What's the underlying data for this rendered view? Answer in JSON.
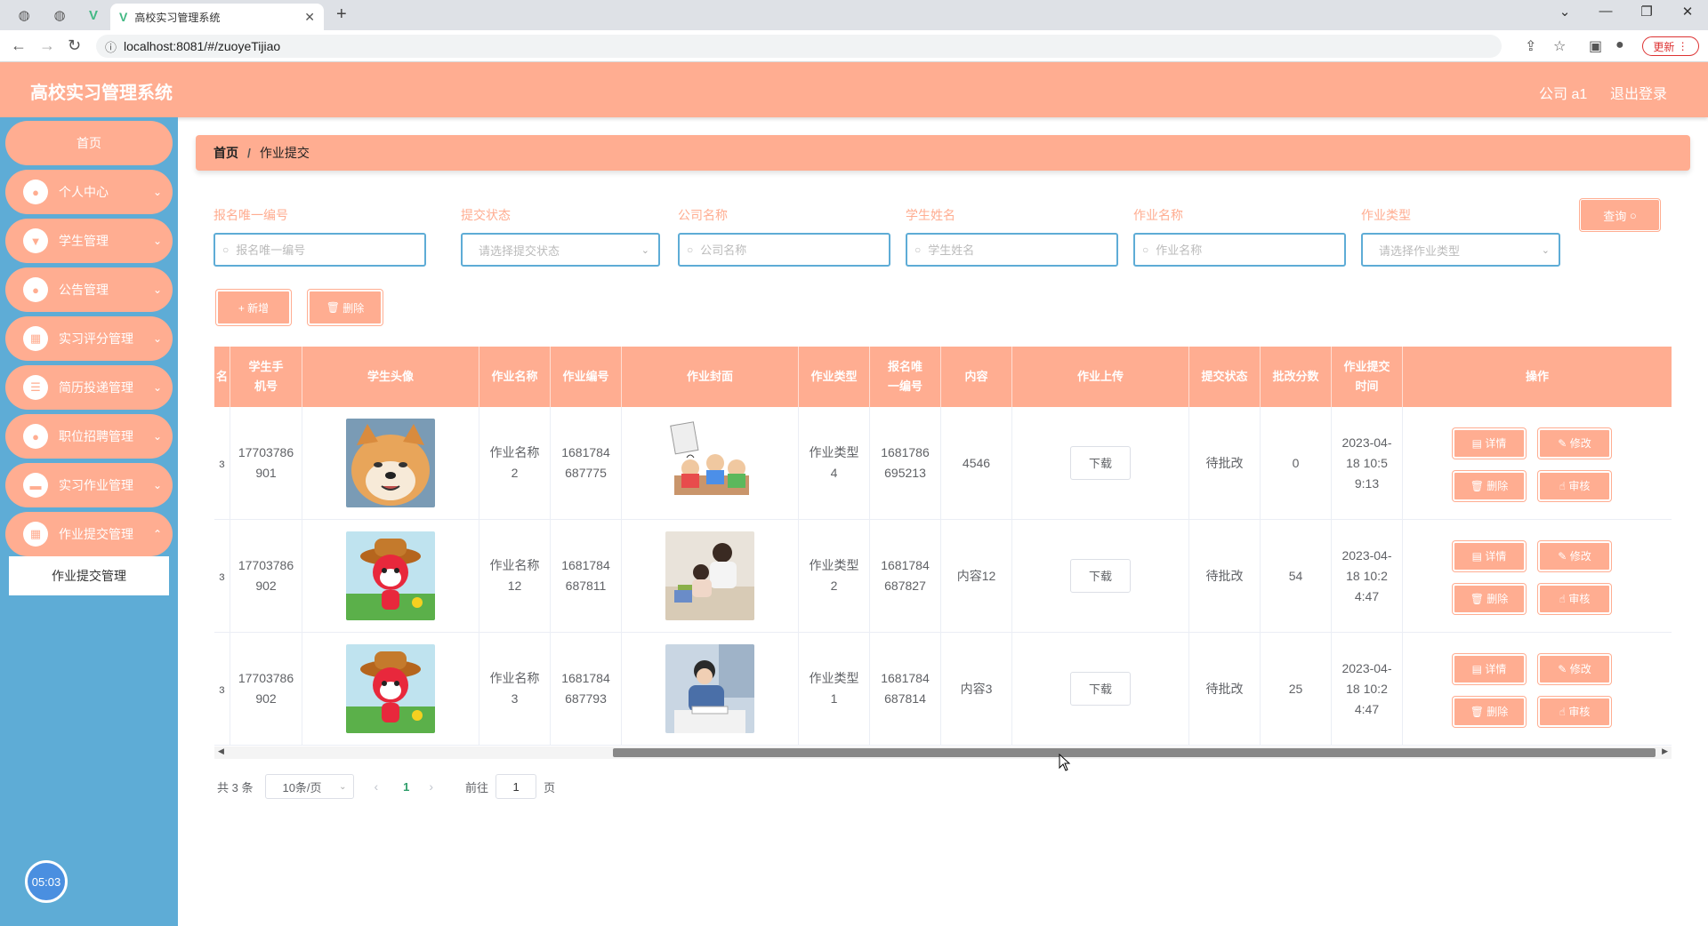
{
  "browser": {
    "tab_title": "高校实习管理系统",
    "url": "localhost:8081/#/zuoyeTijiao",
    "update_label": "更新"
  },
  "header": {
    "title": "高校实习管理系统",
    "user": "公司 a1",
    "logout": "退出登录"
  },
  "sidebar": {
    "items": [
      {
        "label": "首页",
        "icon": "home"
      },
      {
        "label": "个人中心",
        "icon": "user-icon"
      },
      {
        "label": "学生管理",
        "icon": "badge-icon"
      },
      {
        "label": "公告管理",
        "icon": "pin-icon"
      },
      {
        "label": "实习评分管理",
        "icon": "grid-icon"
      },
      {
        "label": "简历投递管理",
        "icon": "list-icon"
      },
      {
        "label": "职位招聘管理",
        "icon": "location-icon"
      },
      {
        "label": "实习作业管理",
        "icon": "monitor-icon"
      },
      {
        "label": "作业提交管理",
        "icon": "grid-icon"
      }
    ],
    "active_sub": "作业提交管理",
    "timer": "05:03"
  },
  "breadcrumb": {
    "home": "首页",
    "sep": "/",
    "current": "作业提交"
  },
  "search": {
    "fields": [
      {
        "label": "报名唯一编号",
        "placeholder": "报名唯一编号",
        "type": "input"
      },
      {
        "label": "提交状态",
        "placeholder": "请选择提交状态",
        "type": "select"
      },
      {
        "label": "公司名称",
        "placeholder": "公司名称",
        "type": "input"
      },
      {
        "label": "学生姓名",
        "placeholder": "学生姓名",
        "type": "input"
      },
      {
        "label": "作业名称",
        "placeholder": "作业名称",
        "type": "input"
      },
      {
        "label": "作业类型",
        "placeholder": "请选择作业类型",
        "type": "select"
      }
    ],
    "query_label": "查询"
  },
  "actions": {
    "add_label": "+ 新增",
    "delete_label": "删除"
  },
  "table": {
    "columns": [
      "学生手机号",
      "学生头像",
      "作业名称",
      "作业编号",
      "作业封面",
      "作业类型",
      "报名唯一编号",
      "内容",
      "作业上传",
      "提交状态",
      "批改分数",
      "作业提交时间",
      "操作"
    ],
    "rows": [
      {
        "phone": "17703786901",
        "avatar": "shiba-dog",
        "hw_name": "作业名称2",
        "hw_no": "1681784687775",
        "cover": "classroom-cartoon",
        "hw_type": "作业类型4",
        "enroll_no": "1681786695213",
        "content": "4546",
        "download": "下载",
        "status": "待批改",
        "score": "0",
        "time": "2023-04-18 10:59:13"
      },
      {
        "phone": "17703786902",
        "avatar": "red-fox-cartoon",
        "hw_name": "作业名称12",
        "hw_no": "1681784687811",
        "cover": "tutoring-photo",
        "hw_type": "作业类型2",
        "enroll_no": "1681784687827",
        "content": "内容12",
        "download": "下载",
        "status": "待批改",
        "score": "54",
        "time": "2023-04-18 10:24:47"
      },
      {
        "phone": "17703786902",
        "avatar": "red-fox-cartoon",
        "hw_name": "作业名称3",
        "hw_no": "1681784687793",
        "cover": "studying-boy-photo",
        "hw_type": "作业类型1",
        "enroll_no": "1681784687814",
        "content": "内容3",
        "download": "下载",
        "status": "待批改",
        "score": "25",
        "time": "2023-04-18 10:24:47"
      }
    ],
    "op_labels": {
      "detail": "详情",
      "edit": "修改",
      "delete": "删除",
      "review": "审核"
    }
  },
  "pagination": {
    "total": "共 3 条",
    "page_size": "10条/页",
    "current": "1",
    "goto_prefix": "前往",
    "goto_value": "1",
    "goto_suffix": "页"
  },
  "colors": {
    "accent": "#ffad91",
    "sidebar": "#5eacd6"
  }
}
